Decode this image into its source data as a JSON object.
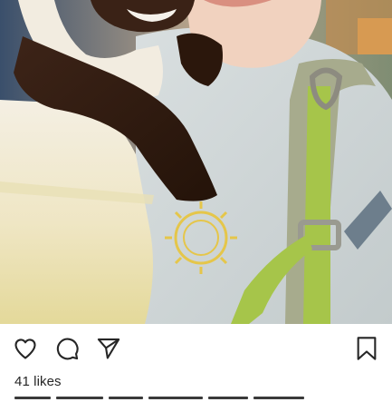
{
  "post": {
    "likes_text": "41 likes"
  },
  "icons": {
    "like": "heart-icon",
    "comment": "comment-icon",
    "share": "send-icon",
    "save": "bookmark-icon"
  },
  "colors": {
    "icon": "#262626",
    "text": "#262626",
    "background": "#ffffff"
  }
}
